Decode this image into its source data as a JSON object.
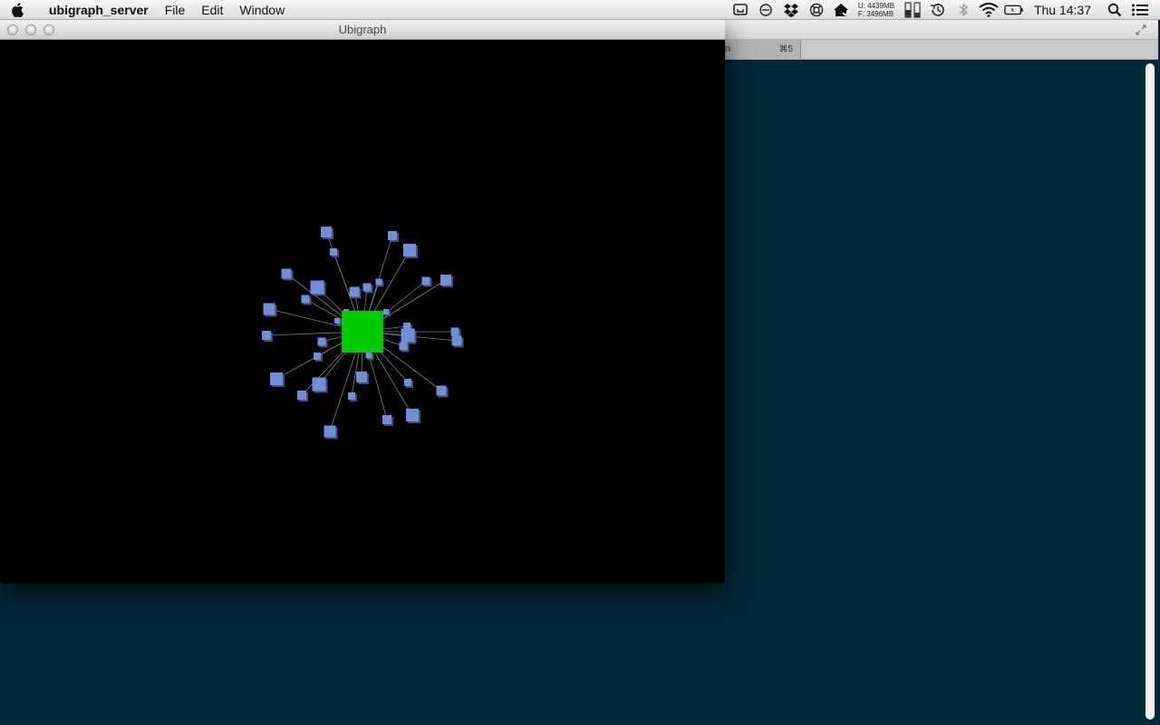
{
  "menubar": {
    "app_name": "ubigraph_server",
    "menus": [
      "File",
      "Edit",
      "Window"
    ],
    "memory": {
      "used": "U: 4439MB",
      "free": "F: 3496MB"
    },
    "clock": "Thu 14:37"
  },
  "ubigraph_window": {
    "title": "Ubigraph"
  },
  "background_window": {
    "tab_text": "n",
    "tab_shortcut": "⌘5"
  },
  "graph": {
    "center_color": "#00cc00",
    "leaf_color": "#6f8fd6",
    "edge_color": "#7f7f7f",
    "leaf_count": 35
  }
}
